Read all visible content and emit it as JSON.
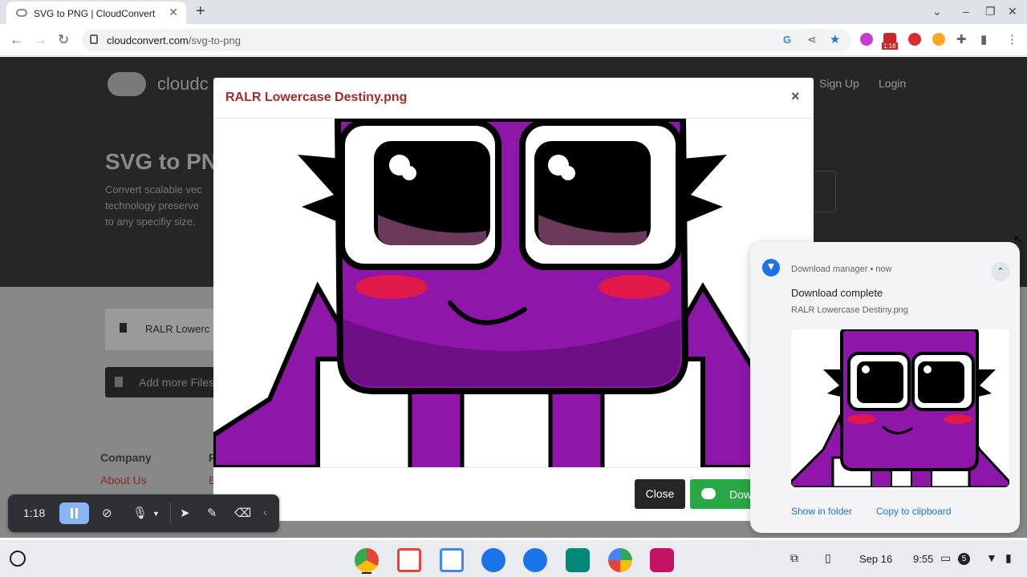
{
  "browser": {
    "tab_title": "SVG to PNG | CloudConvert",
    "new_tab": "+",
    "url_host": "cloudconvert.com",
    "url_path": "/svg-to-png",
    "ext_badge": "1:18"
  },
  "site": {
    "logo_text": "cloudc",
    "nav": {
      "signup": "Sign Up",
      "login": "Login"
    },
    "hero_title": "SVG to PN",
    "hero_desc": [
      "Convert scalable vec",
      "technology preserve",
      "to any specifiy size."
    ],
    "file_name": "RALR Lowerc",
    "add_more": "Add more Files",
    "footer_company": "Company",
    "footer_about": "About Us",
    "footer_r": "R",
    "footer_e": "E"
  },
  "modal": {
    "title": "RALR Lowercase Destiny.png",
    "close_x": "×",
    "close_label": "Close",
    "download_label": "Dow"
  },
  "notification": {
    "source": "Download manager • now",
    "title": "Download complete",
    "file": "RALR Lowercase Destiny.png",
    "show_in_folder": "Show in folder",
    "copy_to_clipboard": "Copy to clipboard"
  },
  "recorder": {
    "time": "1:18"
  },
  "shelf": {
    "date": "Sep 16",
    "time": "9:55",
    "badge": "5"
  },
  "colors": {
    "accent": "#1a73e8",
    "green": "#28a745",
    "modal_title": "#a52a2a",
    "character": "#8e16a8"
  }
}
